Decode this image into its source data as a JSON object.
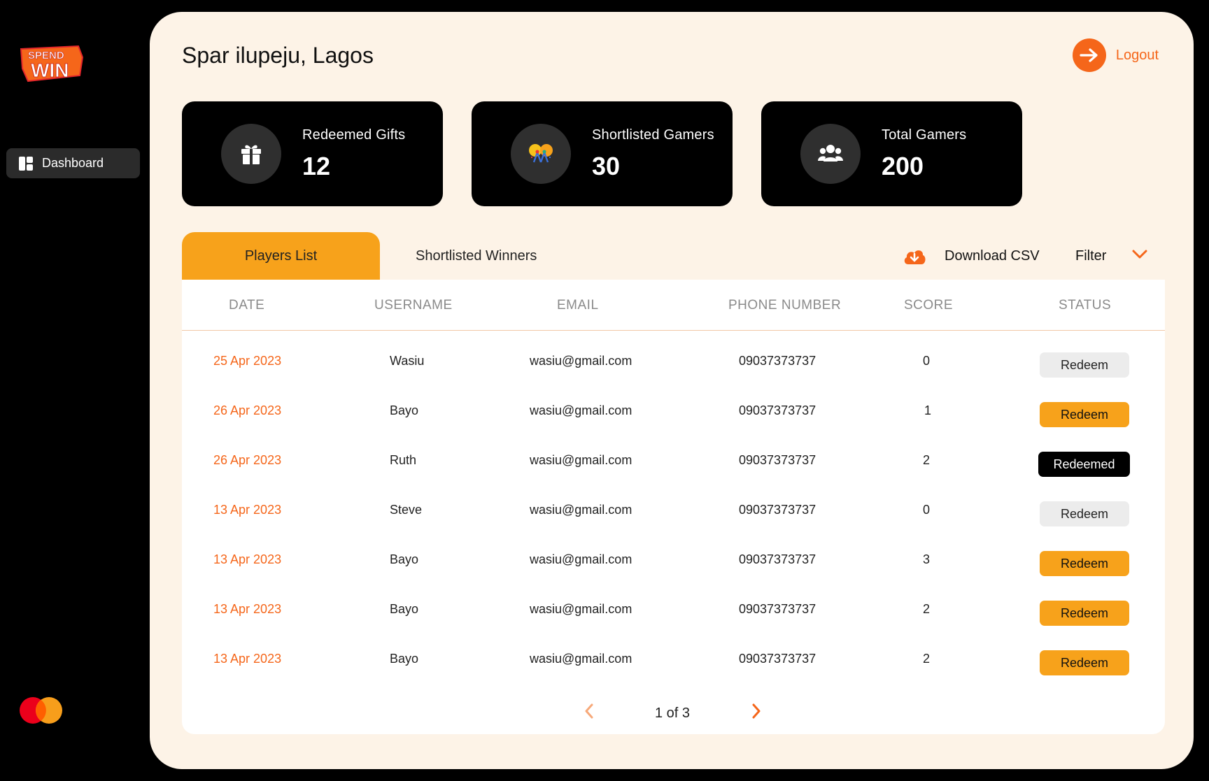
{
  "brand": {
    "logo_text_top": "SPEND",
    "logo_text_bottom": "WIN",
    "accent": "#f5661a",
    "highlight": "#f7a21b"
  },
  "sidebar": {
    "items": [
      {
        "label": "Dashboard",
        "icon": "dashboard-icon"
      }
    ]
  },
  "header": {
    "title": "Spar ilupeju, Lagos",
    "logout_label": "Logout"
  },
  "stats": [
    {
      "label": "Redeemed Gifts",
      "value": "12",
      "icon": "gift-icon"
    },
    {
      "label": "Shortlisted Gamers",
      "value": "30",
      "icon": "celebration-icon"
    },
    {
      "label": "Total Gamers",
      "value": "200",
      "icon": "users-icon"
    }
  ],
  "tabs": [
    {
      "label": "Players List",
      "active": true
    },
    {
      "label": "Shortlisted Winners",
      "active": false
    }
  ],
  "actions": {
    "download_label": "Download CSV",
    "filter_label": "Filter"
  },
  "table": {
    "columns": [
      "DATE",
      "USERNAME",
      "EMAIL",
      "PHONE NUMBER",
      "SCORE",
      "STATUS"
    ],
    "rows": [
      {
        "date": "25 Apr 2023",
        "username": "Wasiu",
        "email": "wasiu@gmail.com",
        "phone": "09037373737",
        "score": "0",
        "status": "Redeem",
        "state": "disabled"
      },
      {
        "date": "26 Apr 2023",
        "username": "Bayo",
        "email": "wasiu@gmail.com",
        "phone": "09037373737",
        "score": "1",
        "status": "Redeem",
        "state": "active"
      },
      {
        "date": "26 Apr 2023",
        "username": "Ruth",
        "email": "wasiu@gmail.com",
        "phone": "09037373737",
        "score": "2",
        "status": "Redeemed",
        "state": "done"
      },
      {
        "date": "13 Apr 2023",
        "username": "Steve",
        "email": "wasiu@gmail.com",
        "phone": "09037373737",
        "score": "0",
        "status": "Redeem",
        "state": "disabled"
      },
      {
        "date": "13 Apr 2023",
        "username": "Bayo",
        "email": "wasiu@gmail.com",
        "phone": "09037373737",
        "score": "3",
        "status": "Redeem",
        "state": "active"
      },
      {
        "date": "13 Apr 2023",
        "username": "Bayo",
        "email": "wasiu@gmail.com",
        "phone": "09037373737",
        "score": "2",
        "status": "Redeem",
        "state": "active"
      },
      {
        "date": "13 Apr 2023",
        "username": "Bayo",
        "email": "wasiu@gmail.com",
        "phone": "09037373737",
        "score": "2",
        "status": "Redeem",
        "state": "active"
      }
    ]
  },
  "pagination": {
    "label": "1 of 3"
  }
}
